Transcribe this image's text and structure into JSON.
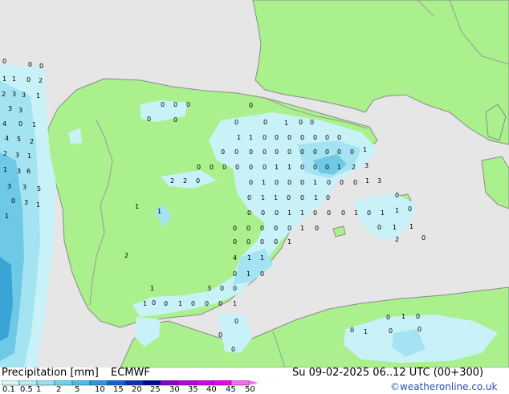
{
  "title": {
    "left": "Precipitation [mm]",
    "model": "ECMWF",
    "datetime": "Su 09-02-2025 06..12 UTC (00+300)",
    "credit": "©weatheronline.co.uk"
  },
  "colors": {
    "sea": "#e6e6e6",
    "land": "#aaf08c",
    "border": "#9a9a9a",
    "coast": "#8a8a8a",
    "precip_light": "#c8f2f7",
    "precip_mid": "#a4e4f2",
    "precip_strong": "#6fc8e6",
    "precip_heavy": "#3aa4d4"
  },
  "legend": {
    "values": [
      "0.1",
      "0.5",
      "1",
      "2",
      "5",
      "10",
      "15",
      "20",
      "25",
      "30",
      "35",
      "40",
      "45",
      "50"
    ],
    "colors": [
      "#d2f5f7",
      "#b4ecf5",
      "#96e1f2",
      "#6ed2ee",
      "#46beea",
      "#2896e0",
      "#1464d2",
      "#0a32b4",
      "#000a8c",
      "#8c00c8",
      "#b400dc",
      "#d200e6",
      "#eb00eb",
      "#f06ef0"
    ]
  },
  "map_labels": [
    "0",
    "0",
    "0",
    "1",
    "1",
    "0",
    "2",
    "2",
    "3",
    "3",
    "1",
    "3",
    "3",
    "4",
    "0",
    "1",
    "4",
    "5",
    "2",
    "2",
    "3",
    "1",
    "1",
    "3",
    "6",
    "3",
    "3",
    "5",
    "0",
    "3",
    "1",
    "1",
    "0",
    "0",
    "0",
    "0",
    "0",
    "0",
    "0",
    "0",
    "1",
    "0",
    "0",
    "1",
    "1",
    "0",
    "0",
    "0",
    "0",
    "0",
    "0",
    "0",
    "0",
    "0",
    "0",
    "0",
    "0",
    "0",
    "0",
    "0",
    "0",
    "0",
    "0",
    "1",
    "0",
    "0",
    "0",
    "0",
    "0",
    "0",
    "1",
    "1",
    "0",
    "0",
    "0",
    "1",
    "2",
    "3",
    "2",
    "2",
    "0",
    "0",
    "1",
    "0",
    "0",
    "0",
    "1",
    "0",
    "0",
    "0",
    "1",
    "3",
    "0",
    "1",
    "1",
    "0",
    "0",
    "1",
    "0",
    "0",
    "1",
    "1",
    "0",
    "0",
    "0",
    "1",
    "1",
    "0",
    "0",
    "0",
    "1",
    "0",
    "1",
    "1",
    "0",
    "0",
    "0",
    "0",
    "0",
    "0",
    "1",
    "0",
    "0",
    "1",
    "1",
    "0",
    "0",
    "0",
    "0",
    "1",
    "2",
    "0",
    "2",
    "4",
    "1",
    "1",
    "0",
    "1",
    "0",
    "3",
    "0",
    "0",
    "1",
    "1",
    "0",
    "0",
    "1",
    "0",
    "0",
    "0",
    "1",
    "0",
    "0",
    "0",
    "0",
    "1",
    "0",
    "0",
    "1",
    "0",
    "0"
  ]
}
